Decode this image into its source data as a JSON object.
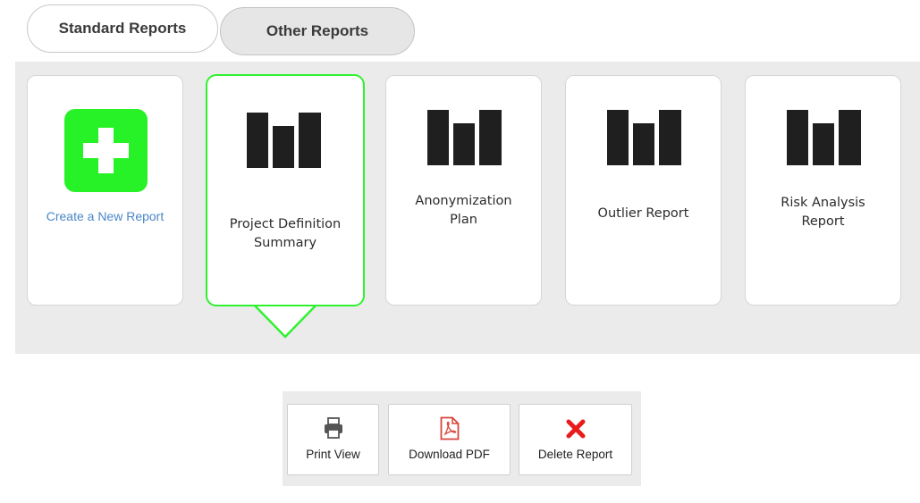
{
  "tabs": [
    {
      "label": "Standard Reports",
      "active": true
    },
    {
      "label": "Other Reports",
      "active": false
    }
  ],
  "cards": {
    "create": {
      "label": "Create a New Report",
      "icon": "plus-icon"
    },
    "project_definition": {
      "label_line1": "Project Definition",
      "label_line2": "Summary",
      "icon": "bar-chart-icon",
      "selected": true
    },
    "anonymization": {
      "label_line1": "Anonymization",
      "label_line2": "Plan",
      "icon": "bar-chart-icon"
    },
    "outlier": {
      "label": "Outlier Report",
      "icon": "bar-chart-icon"
    },
    "risk_analysis": {
      "label_line1": "Risk Analysis",
      "label_line2": "Report",
      "icon": "bar-chart-icon"
    }
  },
  "toolbar": {
    "print": {
      "label": "Print View",
      "icon": "printer-icon"
    },
    "pdf": {
      "label": "Download PDF",
      "icon": "pdf-icon"
    },
    "delete": {
      "label": "Delete Report",
      "icon": "close-icon"
    }
  },
  "colors": {
    "accent_green": "#27f227",
    "selected_border": "#2ff22f",
    "link_blue": "#4a86c8",
    "delete_red": "#e81c1c",
    "pdf_red": "#d9453c",
    "panel_bg": "#ebebeb",
    "icon_dark": "#1f1f1f"
  }
}
